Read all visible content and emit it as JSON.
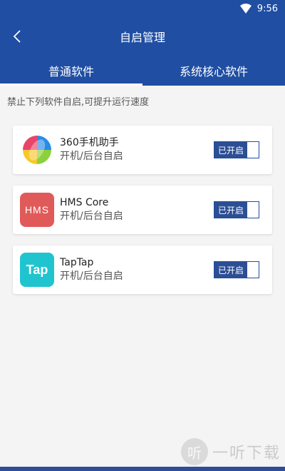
{
  "status_bar": {
    "time": "9:56"
  },
  "header": {
    "title": "自启管理"
  },
  "tabs": [
    {
      "label": "普通软件",
      "active": true
    },
    {
      "label": "系统核心软件",
      "active": false
    }
  ],
  "hint": "禁止下列软件自启,可提升运行速度",
  "apps": [
    {
      "name": "360手机助手",
      "desc": "开机/后台自启",
      "toggle": "已开启",
      "icon": "360-assistant-icon"
    },
    {
      "name": "HMS Core",
      "desc": "开机/后台自启",
      "toggle": "已开启",
      "icon": "hms-core-icon",
      "icon_text": "HMS",
      "icon_color": "#e05a5a"
    },
    {
      "name": "TapTap",
      "desc": "开机/后台自启",
      "toggle": "已开启",
      "icon": "taptap-icon",
      "icon_text": "Tap",
      "icon_color": "#20c4cf"
    }
  ],
  "watermark": {
    "glyph": "听",
    "text": "一听下载"
  },
  "colors": {
    "primary": "#1f4ea3",
    "toggle_on": "#2c4e94"
  }
}
